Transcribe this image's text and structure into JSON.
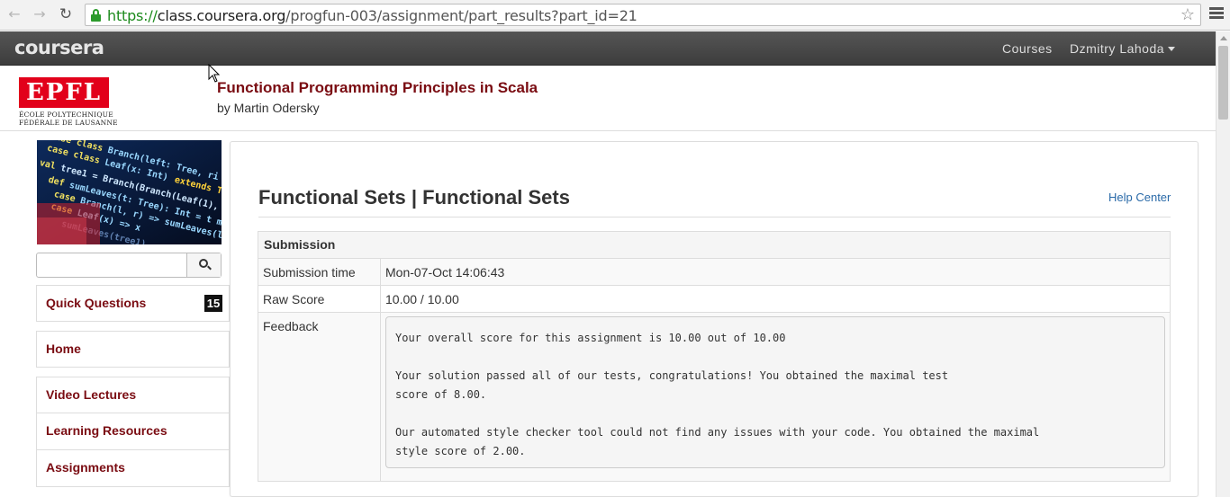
{
  "browser": {
    "url_scheme": "https://",
    "url_host": "class.coursera.org",
    "url_path": "/progfun-003/assignment/part_results?part_id=21",
    "back_icon": "arrow-left-icon",
    "forward_icon": "arrow-right-icon",
    "reload_icon": "reload-icon",
    "bookmark_icon": "star-icon",
    "menu_icon": "hamburger-icon"
  },
  "topbar": {
    "logo": "coursera",
    "courses": "Courses",
    "user": "Dzmitry Lahoda"
  },
  "course": {
    "institution_mark": "EPFL",
    "institution_line1": "ÉCOLE POLYTECHNIQUE",
    "institution_line2": "FÉDÉRALE DE LAUSANNE",
    "title": "Functional Programming Principles in Scala",
    "instructor": "by Martin Odersky"
  },
  "sidebar": {
    "search_placeholder": "",
    "items": [
      {
        "label": "Quick Questions",
        "badge": "15"
      },
      {
        "label": "Home"
      },
      {
        "label": "Video Lectures"
      },
      {
        "label": "Learning Resources"
      },
      {
        "label": "Assignments"
      }
    ]
  },
  "main": {
    "title": "Functional Sets | Functional Sets",
    "help": "Help Center",
    "table": {
      "header": "Submission",
      "rows": [
        {
          "label": "Submission time",
          "value": "Mon-07-Oct 14:06:43"
        },
        {
          "label": "Raw Score",
          "value": "10.00 / 10.00"
        },
        {
          "label": "Feedback"
        }
      ]
    },
    "feedback": [
      "Your overall score for this assignment is 10.00 out of 10.00",
      "",
      "Your solution passed all of our tests, congratulations! You obtained the maximal test",
      "score of 8.00.",
      "",
      "Our automated style checker tool could not find any issues with your code. You obtained the maximal",
      "style score of 2.00."
    ]
  },
  "colors": {
    "brand_red": "#7a0c12",
    "epfl_red": "#e2001a",
    "link_blue": "#2a6aa8",
    "topbar": "#3d3d3d"
  }
}
